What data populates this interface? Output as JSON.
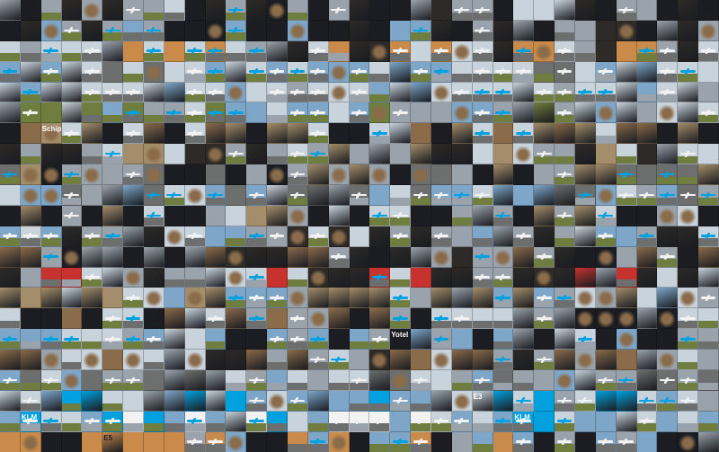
{
  "mosaic": {
    "rows": 22,
    "columns": 35,
    "palette": {
      "sky_light": "#c9d3dc",
      "sky_blue": "#7ea6c9",
      "sky_grey": "#9aa3ab",
      "tarmac": "#6d6f6e",
      "grass": "#6f7d3f",
      "night": "#1b1d22",
      "terminal_dark": "#2d2a27",
      "interior_warm": "#8a6b4a",
      "sunset": "#c98a4a",
      "instagram_tone": "#a48d6a",
      "klm_blue": "#00a1de",
      "red_accent": "#c7322f",
      "white": "#f2f2f2"
    },
    "labels": [
      {
        "name": "schiphol-sign-text",
        "text": "Schiphol",
        "row": 6,
        "col": 2,
        "color": "#ffffff"
      },
      {
        "name": "yotel-sign-text",
        "text": "Yotel",
        "row": 16,
        "col": 19,
        "color": "#ffffff"
      },
      {
        "name": "klm-livery-text",
        "text": "KLM",
        "row": 20,
        "col": 1,
        "color": "#ffffff"
      },
      {
        "name": "gate-e5-text",
        "text": "E5",
        "row": 21,
        "col": 5,
        "color": "#1b1d22"
      },
      {
        "name": "gate-e3-text",
        "text": "E3",
        "row": 19,
        "col": 23,
        "color": "#ffffff"
      },
      {
        "name": "klm-logo-text",
        "text": "KLM",
        "row": 20,
        "col": 25,
        "color": "#ffffff"
      }
    ]
  }
}
